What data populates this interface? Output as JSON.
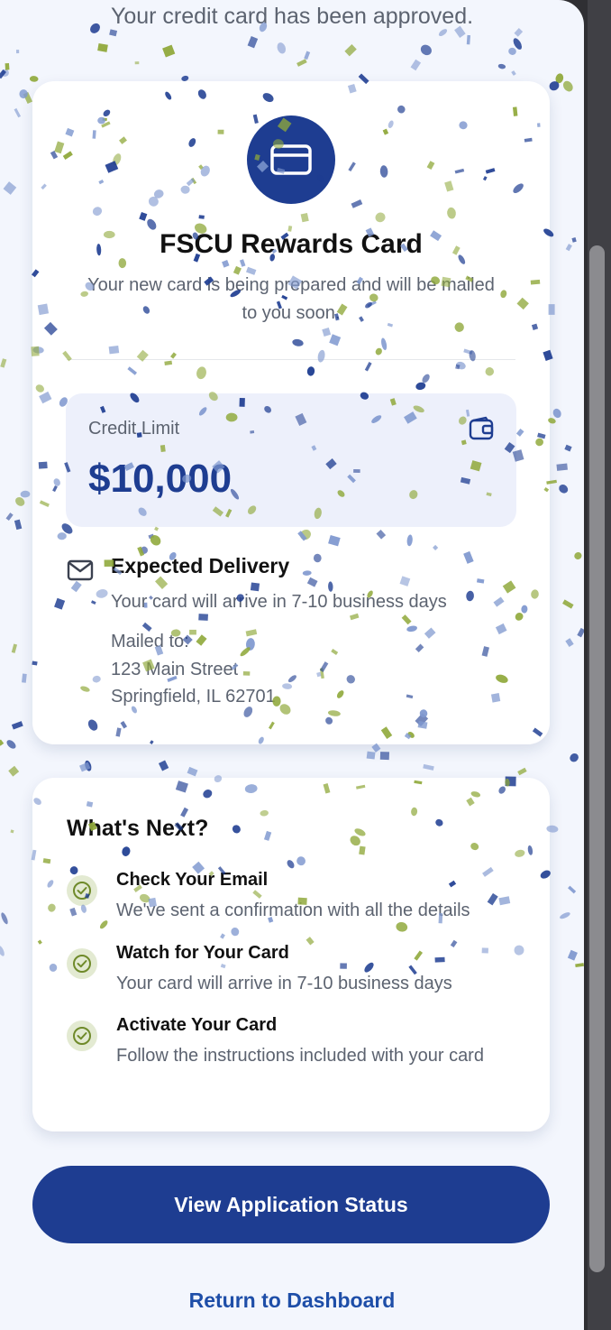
{
  "header": {
    "subtitle": "Your credit card has been approved."
  },
  "card": {
    "name": "FSCU Rewards Card",
    "description": "Your new card is being prepared and will be mailed to you soon.",
    "icon": "credit-card-icon"
  },
  "credit_limit": {
    "label": "Credit Limit",
    "value": "$10,000",
    "icon": "wallet-icon"
  },
  "delivery": {
    "title": "Expected Delivery",
    "subtitle": "Your card will arrive in 7-10 business days",
    "mailed_label": "Mailed to:",
    "address_line1": "123 Main Street",
    "address_line2": "Springfield, IL 62701",
    "icon": "mail-icon"
  },
  "next": {
    "title": "What's Next?",
    "steps": [
      {
        "title": "Check Your Email",
        "description": "We've sent a confirmation with all the details"
      },
      {
        "title": "Watch for Your Card",
        "description": "Your card will arrive in 7-10 business days"
      },
      {
        "title": "Activate Your Card",
        "description": "Follow the instructions included with your card"
      }
    ]
  },
  "actions": {
    "primary_label": "View Application Status",
    "secondary_label": "Return to Dashboard"
  },
  "colors": {
    "brand": "#1e3d91",
    "link": "#1e4ea8",
    "confetti_blue": "#1e3d91",
    "confetti_green": "#8fa83a",
    "confetti_light": "#7f98cf"
  }
}
